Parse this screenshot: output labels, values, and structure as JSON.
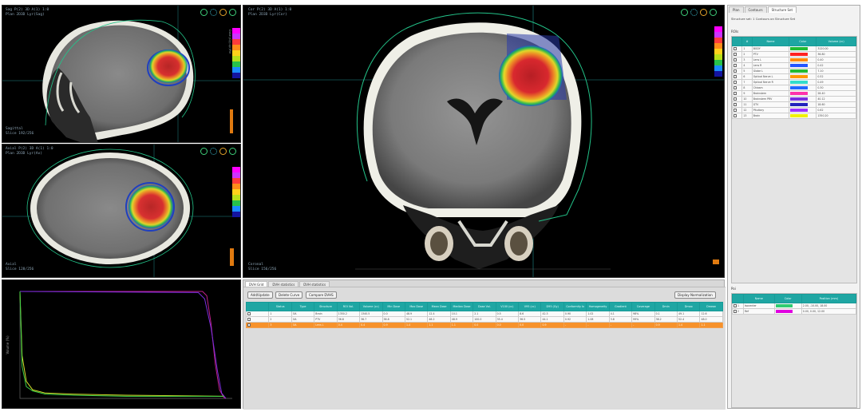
{
  "colors": {
    "accent_teal": "#1fa6a3",
    "selection_orange": "#f7922b",
    "overlay_info": "#8fa7b8",
    "dose_ramp": [
      "#ff00ff",
      "#cc33ff",
      "#ff3b3b",
      "#ff8c1a",
      "#ffd21a",
      "#b8e01a",
      "#26c24b",
      "#1a8cff",
      "#1414a0"
    ]
  },
  "viewports": {
    "sagittal": {
      "info_top": [
        "Sag    P(2)  3D      A(1)   1:0",
        "Plan  2D3D  Lyr(Sag)"
      ],
      "info_bottom": [
        "Sagittal",
        "Slice 192/256"
      ]
    },
    "axial": {
      "info_top": [
        "Axial   P(2)  3D      A(1)   1:0",
        "Plan  2D3D  Lyr(Ax)"
      ],
      "info_bottom": [
        "Axial",
        "Slice 128/256"
      ]
    },
    "coronal": {
      "info_top": [
        "Cor    P(2)  3D      A(1)   1:0",
        "Plan  2D3D  Lyr(Cor)"
      ],
      "info_bottom": [
        "Coronal",
        "Slice 156/256"
      ]
    },
    "colorbar_label": "Dose (Gy) Lyr/Ple"
  },
  "grid": {
    "tabs": [
      "DVH Grid",
      "DVH statistics",
      "DVH statistics"
    ],
    "buttons": {
      "left1": "Add/Update",
      "left2": "Delete Curve",
      "left3": "Compare DVHS",
      "right": "Display Normalization"
    },
    "columns": [
      "",
      "Status",
      "Type",
      "Structure",
      "ROI Vol.",
      "Volume (cc)",
      "Min Dose",
      "Max Dose",
      "Mean Dose",
      "Median Dose",
      "Dose Vol.",
      "V100 (cc)",
      "V95 (cc)",
      "D95 (Gy)",
      "Conformity Ix",
      "Homogeneity",
      "Gradient",
      "Coverage",
      "Dmin",
      "Dmax",
      "Dmean"
    ],
    "rows": [
      [
        "",
        "1",
        "OA",
        "Brain",
        "1350.2",
        "1340.5",
        "0.0",
        "48.9",
        "12.4",
        "10.1",
        "2.1",
        "0.5",
        "8.6",
        "42.3",
        "0.90",
        "1.02",
        "4.1",
        "98%",
        "0.1",
        "49.1",
        "12.6"
      ],
      [
        "",
        "2",
        "OA",
        "PTV",
        "36.8",
        "36.7",
        "38.8",
        "52.1",
        "48.2",
        "48.9",
        "100.0",
        "35.4",
        "36.5",
        "44.1",
        "0.92",
        "1.08",
        "3.8",
        "99%",
        "38.2",
        "52.4",
        "48.0"
      ],
      [
        "",
        "3",
        "OA",
        "Lens L",
        "0.4",
        "0.4",
        "0.9",
        "1.4",
        "1.1",
        "1.1",
        "0.0",
        "0.0",
        "0.0",
        "0.9",
        "-",
        "-",
        "-",
        "-",
        "0.9",
        "1.4",
        "1.1"
      ]
    ]
  },
  "sidebar": {
    "tabs": [
      "Plan",
      "Contours",
      "Structure Set"
    ],
    "search_label": "Structure set: 1  Contours on Structure Set",
    "section1_title": "ROIs",
    "roi_columns": [
      "",
      "#",
      "Name",
      "Color",
      "Volume (cc)"
    ],
    "rois": [
      {
        "n": "1",
        "name": "BODY",
        "color": "#22bb33",
        "vol": "3120.00"
      },
      {
        "n": "2",
        "name": "PTV",
        "color": "#ff2222",
        "vol": "36.80"
      },
      {
        "n": "3",
        "name": "Lens L",
        "color": "#ff8800",
        "vol": "0.40"
      },
      {
        "n": "4",
        "name": "Lens R",
        "color": "#2255ff",
        "vol": "0.42"
      },
      {
        "n": "5",
        "name": "Globe L",
        "color": "#22bb33",
        "vol": "7.10"
      },
      {
        "n": "6",
        "name": "Optical Nerve L",
        "color": "#ff9900",
        "vol": "0.52"
      },
      {
        "n": "7",
        "name": "Optical Nerve R",
        "color": "#33ddcc",
        "vol": "0.49"
      },
      {
        "n": "8",
        "name": "Chiasm",
        "color": "#2266ff",
        "vol": "0.30"
      },
      {
        "n": "9",
        "name": "Brainstem",
        "color": "#ff33aa",
        "vol": "28.40"
      },
      {
        "n": "10",
        "name": "Brainstem PRV",
        "color": "#7b2ee0",
        "vol": "40.12"
      },
      {
        "n": "11",
        "name": "GTV",
        "color": "#2222bb",
        "vol": "18.60"
      },
      {
        "n": "12",
        "name": "Pituitary",
        "color": "#9b30ff",
        "vol": "0.62"
      },
      {
        "n": "13",
        "name": "Brain",
        "color": "#f0f000",
        "vol": "1350.20"
      }
    ],
    "section2_title": "Poi",
    "poi_columns": [
      "",
      "Name",
      "Color",
      "Position (mm)"
    ],
    "pois": [
      {
        "n": "1",
        "name": "Isocenter",
        "color": "#2ecc71",
        "pos": "2.00, -10.00, 18.00"
      },
      {
        "n": "2",
        "name": "Ref",
        "color": "#e000e0",
        "pos": "0.00, 0.00, 12.00"
      }
    ]
  },
  "chart_data": {
    "type": "line",
    "title": "",
    "xlabel": "",
    "ylabel": "Volume (%)",
    "xlim": [
      0,
      100
    ],
    "ylim": [
      0,
      100
    ],
    "grid": false,
    "series": [
      {
        "color": "#c0208a",
        "x": [
          0,
          86,
          88,
          90,
          92,
          94,
          96,
          97
        ],
        "y": [
          100,
          100,
          96,
          70,
          32,
          8,
          1,
          0
        ]
      },
      {
        "color": "#7b2ee0",
        "x": [
          0,
          84,
          87,
          90,
          93,
          95,
          97
        ],
        "y": [
          100,
          99,
          93,
          66,
          26,
          5,
          0
        ]
      },
      {
        "color": "#d7e32a",
        "x": [
          0,
          1,
          3,
          6,
          12,
          25,
          50,
          96
        ],
        "y": [
          100,
          40,
          16,
          8,
          5,
          4,
          3,
          2
        ]
      },
      {
        "color": "#3bd048",
        "x": [
          0,
          1,
          3,
          6,
          12,
          25,
          50,
          96
        ],
        "y": [
          100,
          30,
          11,
          7,
          4,
          3,
          2,
          2
        ]
      }
    ]
  }
}
